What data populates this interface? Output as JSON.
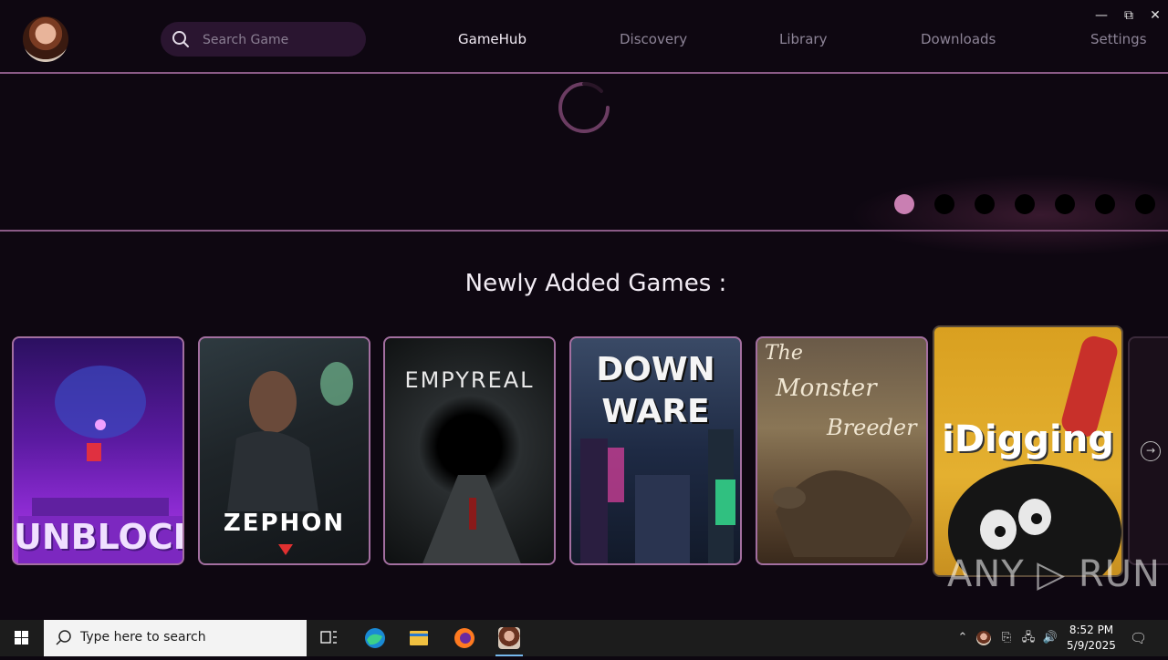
{
  "header": {
    "search_placeholder": "Search Game",
    "nav": [
      "GameHub",
      "Discovery",
      "Library",
      "Downloads",
      "Settings"
    ],
    "active_nav": "GameHub",
    "window_controls": {
      "minimize": "—",
      "restore": "⧉",
      "close": "✕"
    }
  },
  "carousel": {
    "dot_count": 7,
    "active_dot": 1
  },
  "section": {
    "title": "Newly Added Games :",
    "games": [
      {
        "title": "UNBLOCK"
      },
      {
        "title": "ZEPHON"
      },
      {
        "title": "EMPYREAL"
      },
      {
        "title_line1": "DOWN",
        "title_line2": "WARE"
      },
      {
        "title_line1": "The",
        "title_line2": "Monster",
        "title_line3": "Breeder"
      },
      {
        "title": "iDigging"
      }
    ],
    "next_arrow": "→"
  },
  "watermark": "ANY ▷ RUN",
  "taskbar": {
    "search_placeholder": "Type here to search",
    "time": "8:52 PM",
    "date": "5/9/2025"
  },
  "colors": {
    "accent": "#c97fb2",
    "border": "#8a5a86",
    "background": "#0e0711"
  }
}
